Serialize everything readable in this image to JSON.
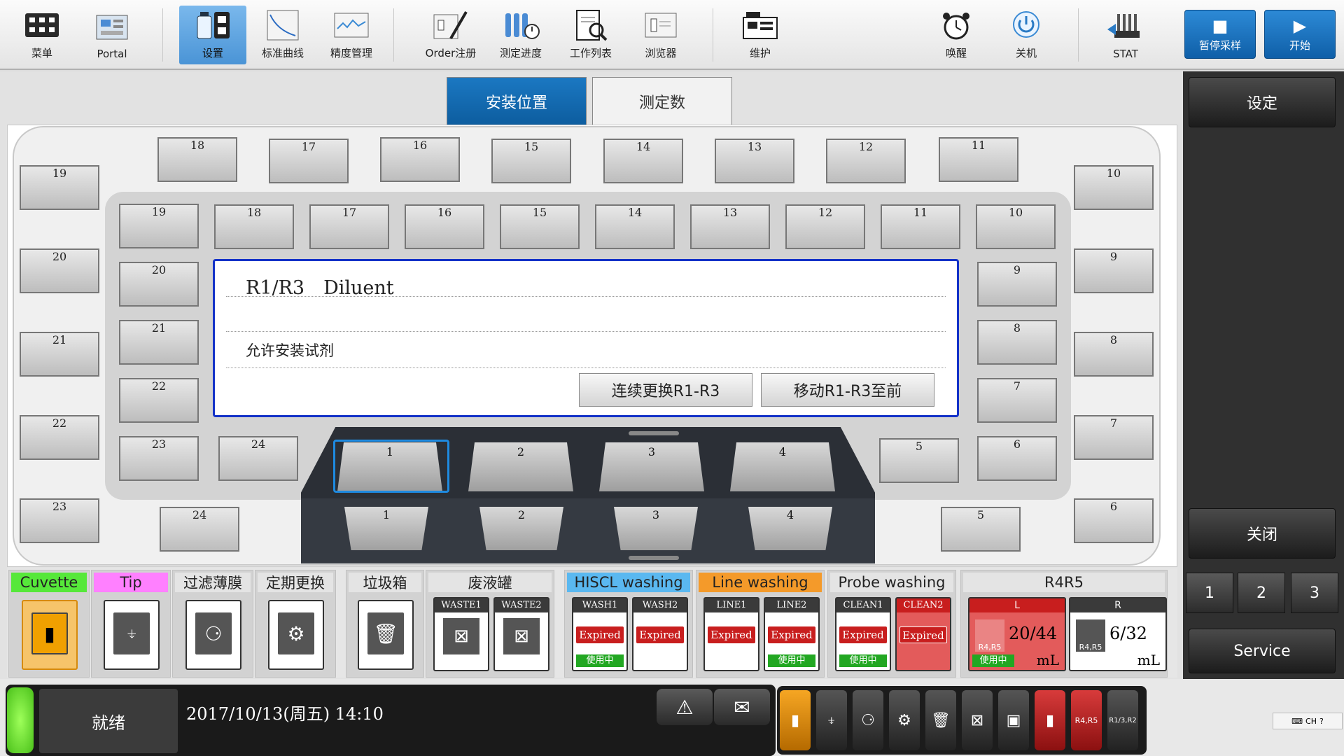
{
  "toolbar": {
    "menu": "菜单",
    "portal": "Portal",
    "settings": "设置",
    "std_curve": "标准曲线",
    "precision": "精度管理",
    "order": "Order注册",
    "progress": "测定进度",
    "worklist": "工作列表",
    "browser": "浏览器",
    "maintenance": "维护",
    "wake": "唤醒",
    "shutdown": "关机",
    "stat": "STAT",
    "pause": "暂停采样",
    "start": "开始"
  },
  "tabs": {
    "install": "安装位置",
    "count": "测定数"
  },
  "outer_slots": {
    "top": [
      "18",
      "17",
      "16",
      "15",
      "14",
      "13",
      "12",
      "11"
    ],
    "left": [
      "19",
      "20",
      "21",
      "22",
      "23"
    ],
    "right": [
      "10",
      "9",
      "8",
      "7",
      "6"
    ],
    "bottom_left": "24",
    "bottom_right": "5"
  },
  "inner_slots": {
    "top": [
      "19",
      "18",
      "17",
      "16",
      "15",
      "14",
      "13",
      "12",
      "11",
      "10"
    ],
    "left": [
      "20",
      "21",
      "22",
      "23"
    ],
    "right": [
      "9",
      "8",
      "7",
      "6"
    ],
    "bottom_left": "24",
    "bottom_right": "5"
  },
  "tray": {
    "upper": [
      "1",
      "2",
      "3",
      "4"
    ],
    "lower": [
      "1",
      "2",
      "3",
      "4"
    ]
  },
  "info": {
    "title": "R1/R3　Diluent",
    "message": "允许安装试剂",
    "btn_replace": "连续更换R1-R3",
    "btn_move": "移动R1-R3至前"
  },
  "consumables": {
    "cuvette": "Cuvette",
    "tip": "Tip",
    "filter": "过滤薄膜",
    "periodic": "定期更换",
    "trash": "垃圾箱",
    "waste": "废液罐",
    "waste1": "WASTE1",
    "waste2": "WASTE2",
    "hiscl": "HISCL washing",
    "wash1": "WASH1",
    "wash2": "WASH2",
    "line": "Line washing",
    "line1": "LINE1",
    "line2": "LINE2",
    "probe": "Probe washing",
    "clean1": "CLEAN1",
    "clean2": "CLEAN2",
    "expired": "Expired",
    "in_use": "使用中",
    "r4r5": "R4R5",
    "r4r5_icon": "R4,R5",
    "l": "L",
    "r": "R",
    "l_val": "20/44",
    "r_val": "6/32",
    "unit": "mL"
  },
  "right_panel": {
    "settings": "设定",
    "close": "关闭",
    "n1": "1",
    "n2": "2",
    "n3": "3",
    "service": "Service"
  },
  "status": {
    "ready": "就绪",
    "datetime": "2017/10/13(周五) 14:10",
    "mini_last": "R1/3,R2",
    "tray_text": "CH"
  },
  "colors": {
    "accent_blue": "#0d5d9f",
    "cuvette_green": "#56e83a",
    "tip_pink": "#ff80ff",
    "hiscl_blue": "#5ab8f0",
    "line_orange": "#f49a2a",
    "expired_red": "#c81e1e",
    "in_use_green": "#22a722"
  }
}
